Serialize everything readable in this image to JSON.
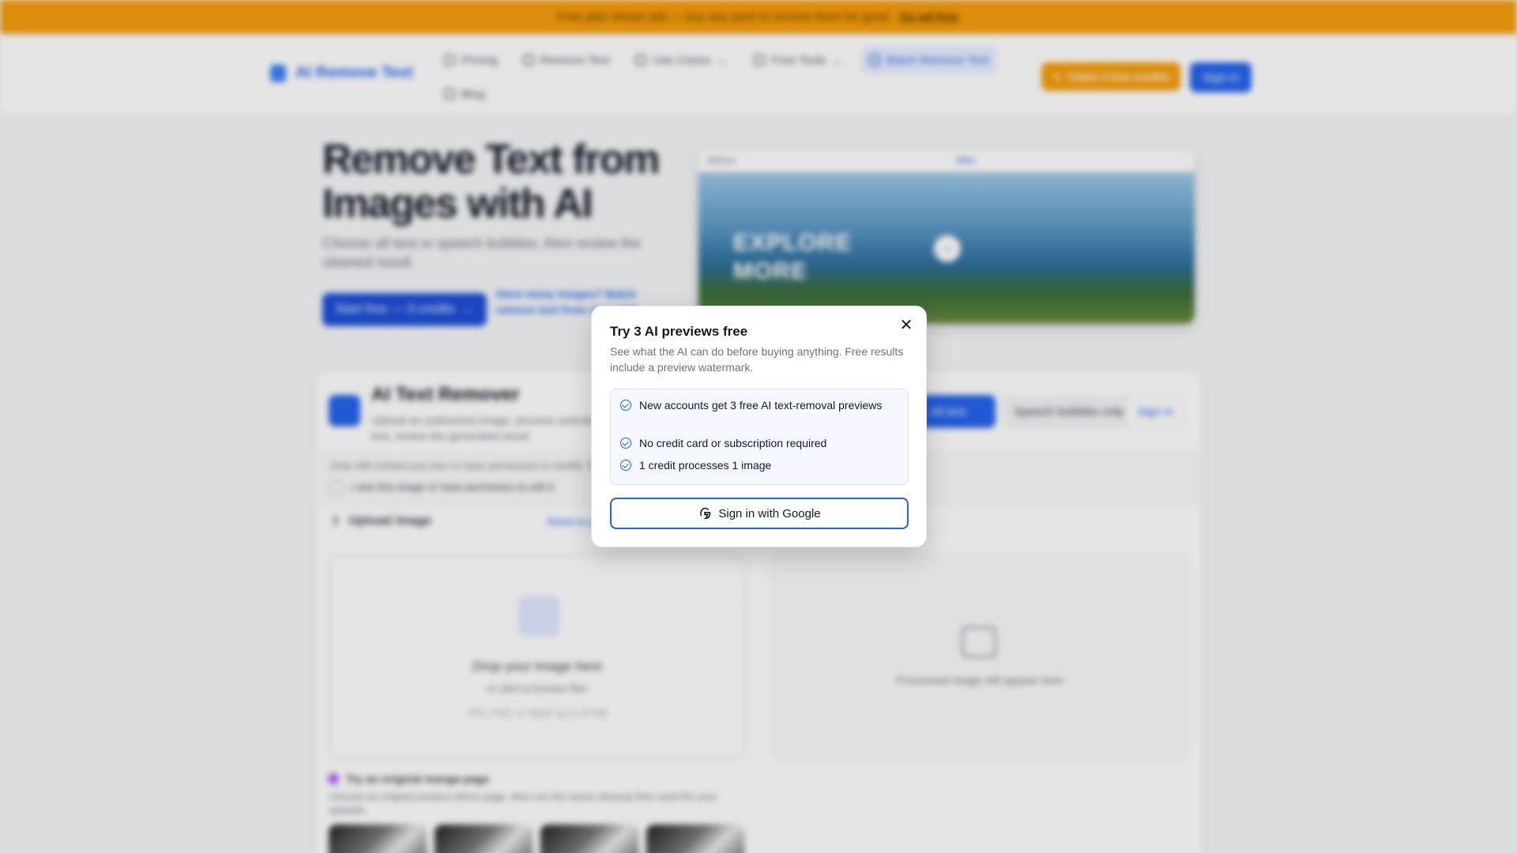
{
  "banner": {
    "text": "Free plan shows ads — buy any pack to remove them for good.",
    "link": "Go ad-free"
  },
  "nav": {
    "logo": "AI Remove Text",
    "items": [
      {
        "label": "Pricing",
        "icon": "pricing-icon"
      },
      {
        "label": "Remove Text",
        "icon": "wand-icon"
      },
      {
        "label": "Use Cases",
        "icon": "grid-icon"
      },
      {
        "label": "Free Tools",
        "icon": "tools-icon"
      },
      {
        "label": "Batch Remove Text",
        "icon": "batch-icon"
      },
      {
        "label": "Blog",
        "icon": "blog-icon"
      }
    ],
    "credits_button": "Claim 3 free credits",
    "signin_button": "Sign in"
  },
  "hero": {
    "title": "Remove Text from Images with AI",
    "subtitle": "Choose all text or speech bubbles, then review the cleaned result.",
    "cta": "Start free — 3 credits",
    "batch_link": "Have many images? Batch remove text from up to 200"
  },
  "compare": {
    "before_label": "Before",
    "after_label": "After",
    "overlay_text": "EXPLORE MORE"
  },
  "tool": {
    "title": "AI Text Remover",
    "description": "Upload an authorized image, process selected text, review the generated result",
    "mode_all": "All text",
    "mode_bubbles": "Speech bubbles only",
    "signin": "Sign in",
    "notice": "Only edit content you own or have permission to modify. Do not use this tool to remove watermarks or copyright material.",
    "consent": "I own this image or have permission to edit it",
    "upload_label": "Upload image",
    "need_link": "Need to process more?",
    "dropzone_title": "Drop your image here",
    "dropzone_sub": "or click to browse files",
    "dropzone_formats": "JPG, PNG, or WebP up to 10 MB",
    "result_placeholder": "Processed image will appear here",
    "manga_title": "Try an original manga page",
    "manga_desc": "Choose an original product demo page, then run the same cleanup flow used for your uploads."
  },
  "modal": {
    "title": "Try 3 AI previews free",
    "subtitle": "See what the AI can do before buying anything. Free results include a preview watermark.",
    "perks": [
      "New accounts get 3 free AI text-removal previews",
      "No credit card or subscription required",
      "1 credit processes 1 image"
    ],
    "google_button": "Sign in with Google",
    "close_icon": "close-icon"
  },
  "colors": {
    "accent": "#2563eb",
    "banner": "#f59e0b"
  }
}
